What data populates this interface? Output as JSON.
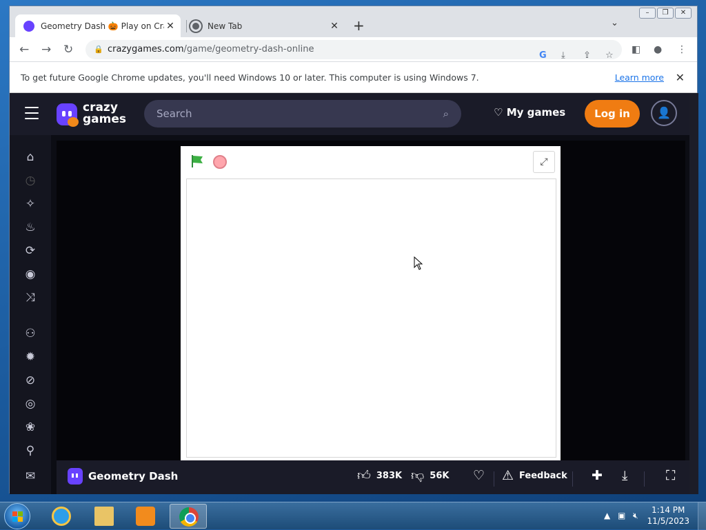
{
  "browser": {
    "tabs": [
      {
        "title": "Geometry Dash 🎃 Play on CrazyG",
        "active": true
      },
      {
        "title": "New Tab",
        "active": false
      }
    ],
    "new_tab_label": "+",
    "address": {
      "domain": "crazygames.com",
      "path": "/game/geometry-dash-online"
    },
    "infobar": {
      "message": "To get future Google Chrome updates, you'll need Windows 10 or later. This computer is using Windows 7.",
      "link": "Learn more"
    }
  },
  "site": {
    "logo_line1": "crazy",
    "logo_line2": "games",
    "search_placeholder": "Search",
    "my_games": "My games",
    "login": "Log in",
    "sidebar_icons": [
      "home-icon",
      "recent-icon",
      "new-icon",
      "trending-icon",
      "updated-icon",
      "originals-icon",
      "random-icon",
      "multiplayer-icon",
      "action-icon",
      "adventure-icon",
      "basketball-icon",
      "flower-icon",
      "bike-icon",
      "mail-icon"
    ]
  },
  "game": {
    "title": "Geometry Dash",
    "likes": "383K",
    "dislikes": "56K",
    "feedback": "Feedback"
  },
  "taskbar": {
    "time": "1:14 PM",
    "date": "11/5/2023"
  },
  "colors": {
    "accent": "#6842ff",
    "login": "#f07c12",
    "site_bg": "#0c0d14"
  }
}
